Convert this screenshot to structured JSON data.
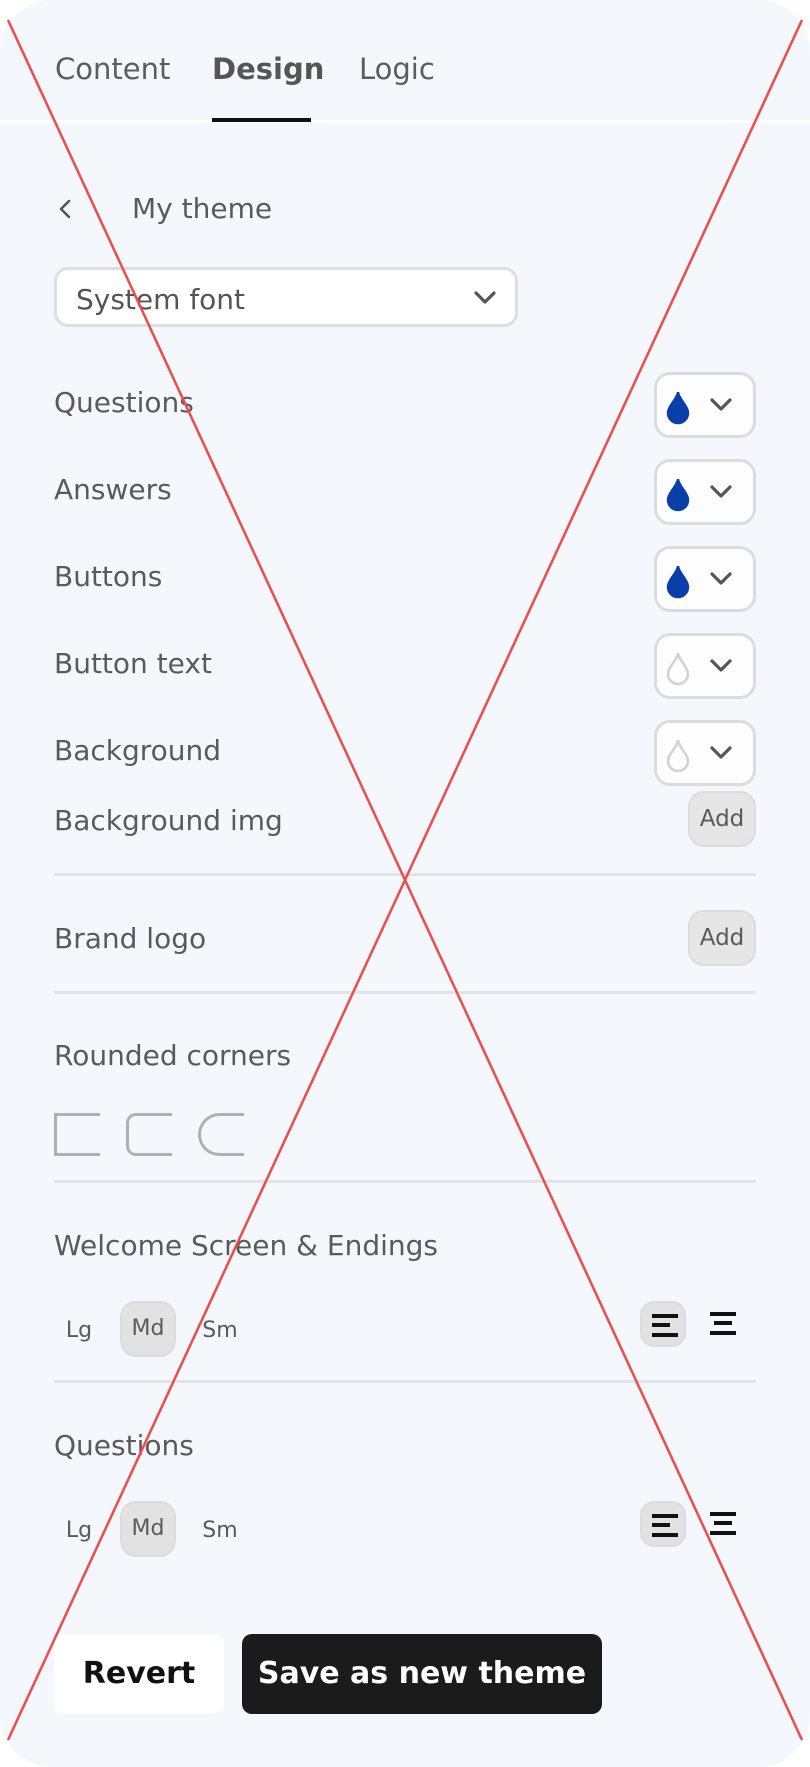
{
  "tabs": [
    {
      "label": "Content",
      "active": false
    },
    {
      "label": "Design",
      "active": true
    },
    {
      "label": "Logic",
      "active": false
    }
  ],
  "theme": {
    "back_icon": "chevron-left-icon",
    "name": "My theme"
  },
  "font_select": {
    "value": "System font",
    "icon": "chevron-down-icon"
  },
  "colors": [
    {
      "label": "Questions",
      "color": "#0a3ea8",
      "filled": true
    },
    {
      "label": "Answers",
      "color": "#0a3ea8",
      "filled": true
    },
    {
      "label": "Buttons",
      "color": "#0a3ea8",
      "filled": true
    },
    {
      "label": "Button text",
      "color": "#ffffff",
      "filled": false
    },
    {
      "label": "Background",
      "color": "#ffffff",
      "filled": false
    }
  ],
  "background_img": {
    "label": "Background img",
    "button": "Add"
  },
  "brand_logo": {
    "label": "Brand logo",
    "button": "Add"
  },
  "rounded_corners": {
    "label": "Rounded corners",
    "options": [
      "none",
      "small",
      "large"
    ]
  },
  "welcome_screen": {
    "label": "Welcome Screen & Endings",
    "sizes": [
      "Lg",
      "Md",
      "Sm"
    ],
    "selected_size": "Md",
    "alignments": [
      "left",
      "center"
    ],
    "selected_alignment": "left"
  },
  "questions_layout": {
    "label": "Questions",
    "sizes": [
      "Lg",
      "Md",
      "Sm"
    ],
    "selected_size": "Md",
    "alignments": [
      "left",
      "center"
    ],
    "selected_alignment": "left"
  },
  "actions": {
    "revert": "Revert",
    "save": "Save as new theme"
  },
  "overlay_color": "#f04a4a"
}
